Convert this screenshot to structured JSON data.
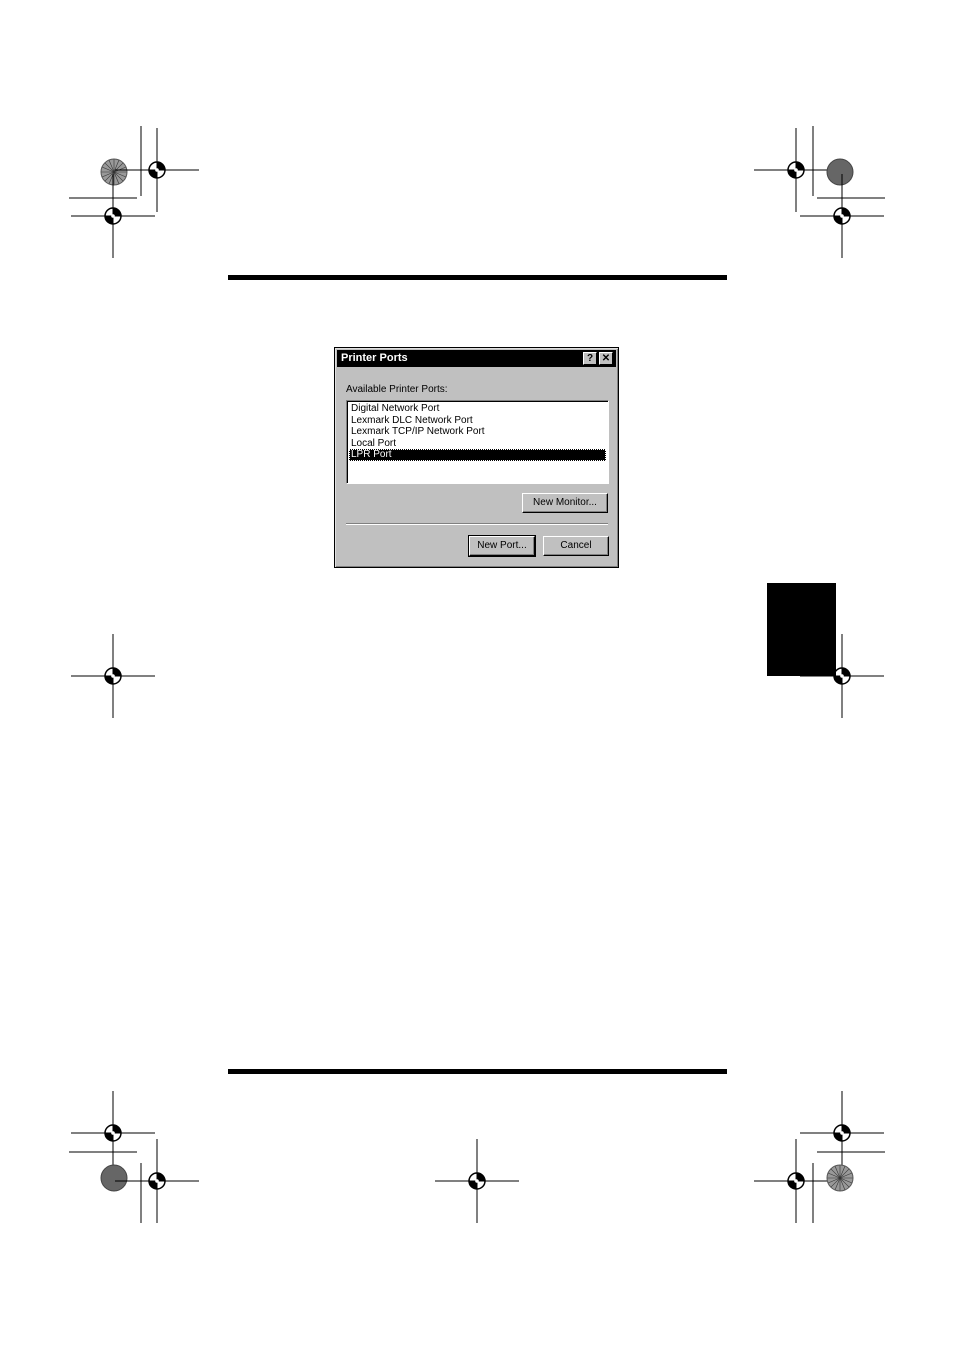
{
  "dialog": {
    "title": "Printer Ports",
    "help_glyph": "?",
    "close_glyph": "✕",
    "ports_label": "Available Printer Ports:",
    "ports": [
      "Digital Network Port",
      "Lexmark DLC Network Port",
      "Lexmark TCP/IP Network Port",
      "Local Port",
      "LPR Port"
    ],
    "selected_port": "LPR Port",
    "new_monitor_label": "New Monitor...",
    "new_port_label": "New Port...",
    "cancel_label": "Cancel"
  },
  "icons": {
    "registration": "registration-mark-icon",
    "color_wheel": "color-wheel-icon"
  },
  "colors": {
    "dialog_face": "#c0c0c0",
    "title_bar": "#000000",
    "selection": "#000000",
    "page_rule": "#000000"
  }
}
